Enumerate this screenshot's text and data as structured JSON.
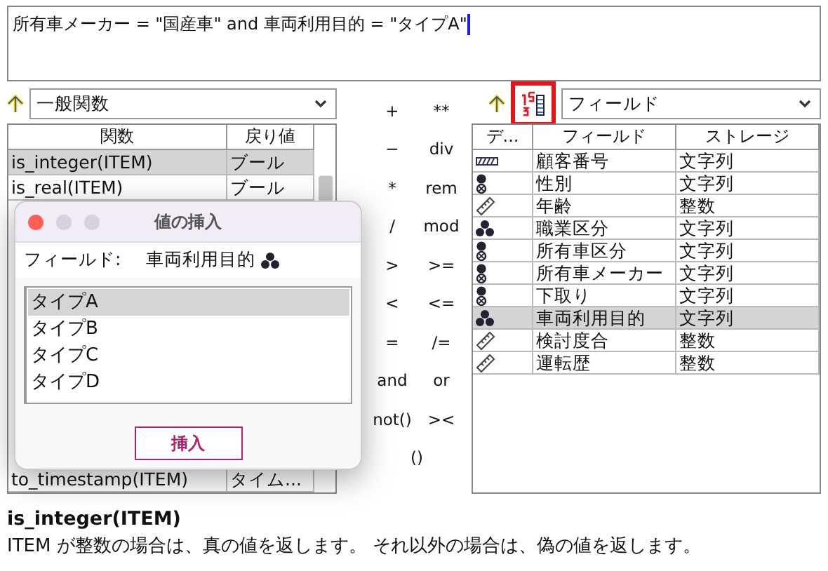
{
  "expression": {
    "value": "所有車メーカー = \"国産車\" and 車両利用目的 = \"タイプA\""
  },
  "functions": {
    "category": "一般関数",
    "columns": [
      "関数",
      "戻り値"
    ],
    "rows": [
      {
        "name": "is_integer(ITEM)",
        "returns": "ブール",
        "selected": true
      },
      {
        "name": "is_real(ITEM)",
        "returns": "ブール",
        "selected": false
      }
    ],
    "last_row": {
      "name": "to_timestamp(ITEM)",
      "returns": "タイム..."
    }
  },
  "operators": [
    [
      "+",
      "**"
    ],
    [
      "−",
      "div"
    ],
    [
      "*",
      "rem"
    ],
    [
      "/",
      "mod"
    ],
    [
      ">",
      ">="
    ],
    [
      "<",
      "<="
    ],
    [
      "=",
      "/="
    ],
    [
      "and",
      "or"
    ],
    [
      "not()",
      "><"
    ],
    [
      "()"
    ]
  ],
  "fields": {
    "sort_highlighted": true,
    "source": "フィールド",
    "columns": [
      "デ...",
      "フィールド",
      "ストレージ"
    ],
    "rows": [
      {
        "kind": "typeless",
        "name": "顧客番号",
        "storage": "文字列",
        "selected": false
      },
      {
        "kind": "flag",
        "name": "性別",
        "storage": "文字列",
        "selected": false
      },
      {
        "kind": "range",
        "name": "年齢",
        "storage": "整数",
        "selected": false
      },
      {
        "kind": "set",
        "name": "職業区分",
        "storage": "文字列",
        "selected": false
      },
      {
        "kind": "flag",
        "name": "所有車区分",
        "storage": "文字列",
        "selected": false
      },
      {
        "kind": "flag",
        "name": "所有車メーカー",
        "storage": "文字列",
        "selected": false
      },
      {
        "kind": "flag",
        "name": "下取り",
        "storage": "文字列",
        "selected": false
      },
      {
        "kind": "set",
        "name": "車両利用目的",
        "storage": "文字列",
        "selected": true
      },
      {
        "kind": "range",
        "name": "検討度合",
        "storage": "整数",
        "selected": false
      },
      {
        "kind": "range",
        "name": "運転歴",
        "storage": "整数",
        "selected": false
      }
    ]
  },
  "dialog": {
    "title": "値の挿入",
    "field_label": "フィールド:",
    "field_value": "車両利用目的",
    "values": [
      {
        "label": "タイプA",
        "selected": true
      },
      {
        "label": "タイプB",
        "selected": false
      },
      {
        "label": "タイプC",
        "selected": false
      },
      {
        "label": "タイプD",
        "selected": false
      }
    ],
    "button": "挿入"
  },
  "description": {
    "title": "is_integer(ITEM)",
    "text": "ITEM が整数の場合は、真の値を返します。 それ以外の場合は、偽の値を返します。"
  }
}
